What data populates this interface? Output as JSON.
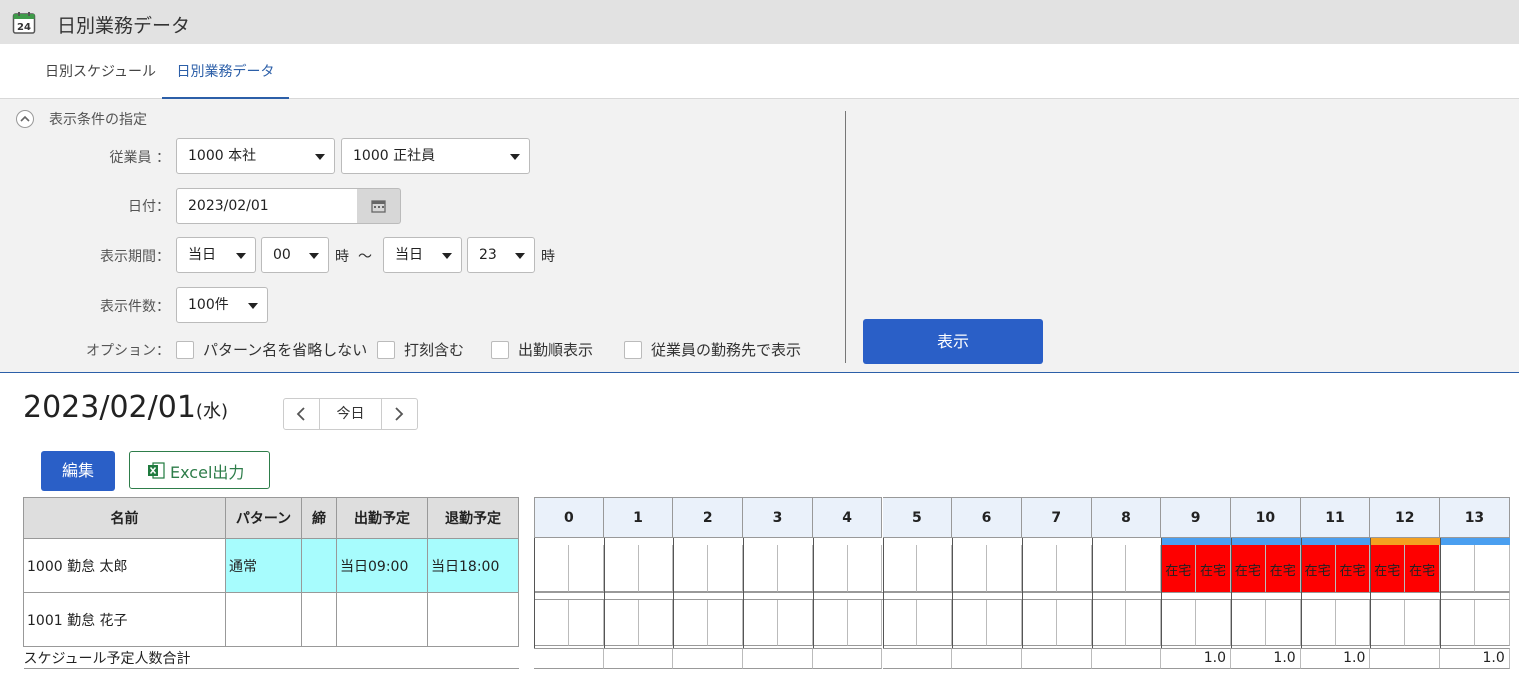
{
  "app": {
    "title": "日別業務データ",
    "icon": "calendar-24-icon"
  },
  "tabs": [
    {
      "label": "日別スケジュール",
      "active": false
    },
    {
      "label": "日別業務データ",
      "active": true
    }
  ],
  "filter": {
    "title": "表示条件の指定",
    "employee_label": "従業員 ：",
    "employee_select1": "1000 本社",
    "employee_select2": "1000 正社員",
    "date_label": "日付：",
    "date_value": "2023/02/01",
    "period_label": "表示期間：",
    "period_from_day": "当日",
    "period_from_hour": "00",
    "hour_unit1": "時",
    "tilde": "～",
    "period_to_day": "当日",
    "period_to_hour": "23",
    "hour_unit2": "時",
    "count_label": "表示件数：",
    "count_value": "100件",
    "options_label": "オプション：",
    "options": [
      {
        "label": "パターン名を省略しない",
        "checked": false
      },
      {
        "label": "打刻含む",
        "checked": false
      },
      {
        "label": "出勤順表示",
        "checked": false
      },
      {
        "label": "従業員の勤務先で表示",
        "checked": false
      }
    ],
    "show_button": "表示"
  },
  "date_header": {
    "date": "2023/02/01",
    "dow": "(水)",
    "today_label": "今日"
  },
  "actions": {
    "edit_label": "編集",
    "excel_label": "Excel出力"
  },
  "table": {
    "columns": [
      "名前",
      "パターン",
      "締",
      "出勤予定",
      "退勤予定"
    ],
    "rows": [
      {
        "name": "1000 勤怠 太郎",
        "pattern": "通常",
        "close": "",
        "start": "当日09:00",
        "end": "当日18:00"
      },
      {
        "name": "1001 勤怠 花子",
        "pattern": "",
        "close": "",
        "start": "",
        "end": ""
      }
    ],
    "summary_label": "スケジュール予定人数合計"
  },
  "timeline": {
    "hours": [
      "0",
      "1",
      "2",
      "3",
      "4",
      "5",
      "6",
      "7",
      "8",
      "9",
      "10",
      "11",
      "12",
      "13"
    ],
    "cell_label": "在宅",
    "bar_colors": {
      "normal": "#4a9ff0",
      "break": "#f4a020"
    },
    "work_color": "#fe0000",
    "summary": [
      "",
      "",
      "",
      "",
      "",
      "",
      "",
      "",
      "",
      "1.0",
      "1.0",
      "1.0",
      "",
      "1.0"
    ]
  }
}
